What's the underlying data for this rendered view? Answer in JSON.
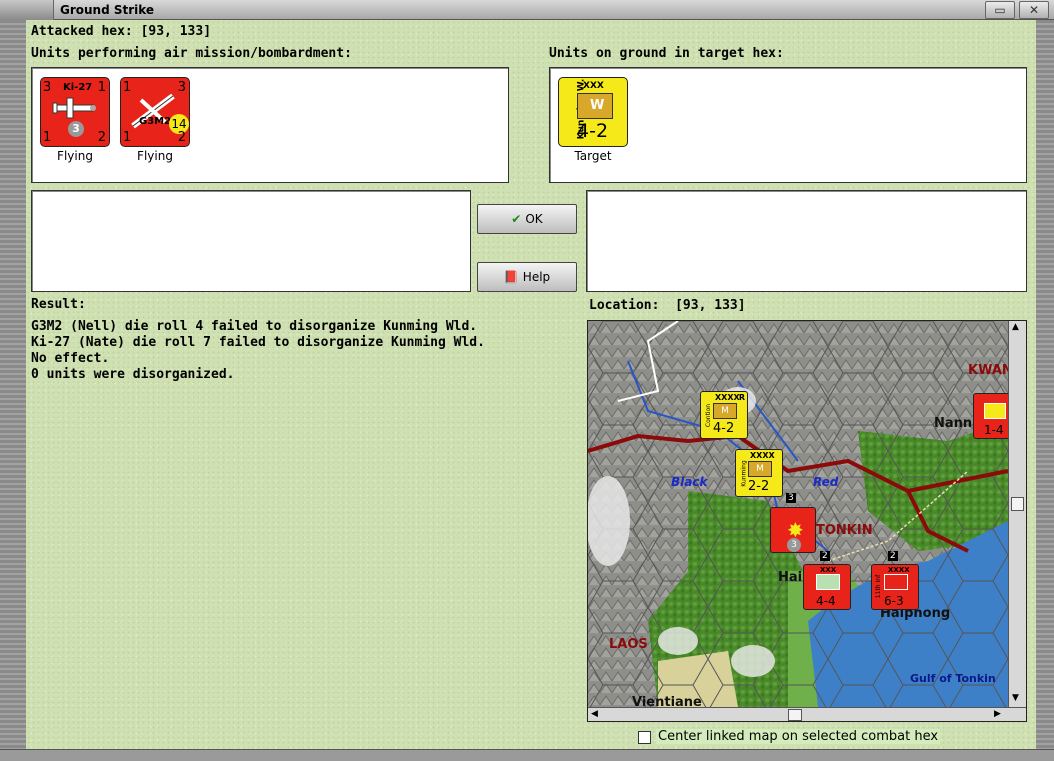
{
  "window": {
    "title": "Ground Strike"
  },
  "attacked": {
    "label": "Attacked hex:",
    "value": "[93, 133]"
  },
  "air_units": {
    "label": "Units performing air mission/bombardment:",
    "units": [
      {
        "name": "Ki-27",
        "tl": "3",
        "tr": "1",
        "bl": "1",
        "br": "2",
        "step": "3",
        "status": "Flying",
        "color": "#e8241a"
      },
      {
        "name": "G3M2",
        "tl": "1",
        "tr": "3",
        "bl": "1",
        "br": "2",
        "step": "14",
        "status": "Flying",
        "color": "#e8241a"
      }
    ]
  },
  "ground_units": {
    "label": "Units on ground in target hex:",
    "units": [
      {
        "name": "Kunming W.",
        "size": "XXX",
        "type": "W",
        "strength": "4-2",
        "status": "Target",
        "color": "#f5e91a"
      }
    ]
  },
  "buttons": {
    "ok": "OK",
    "help": "Help"
  },
  "result": {
    "label": "Result:",
    "lines": [
      "G3M2 (Nell) die roll 4 failed to disorganize Kunming Wld.",
      "Ki-27 (Nate) die roll 7 failed to disorganize Kunming Wld.",
      "No effect.",
      "0 units were disorganized."
    ]
  },
  "location": {
    "label": "Location:",
    "value": "[93, 133]"
  },
  "map": {
    "labels": [
      "KWAN",
      "Nann",
      "Black",
      "Red",
      "TONKIN",
      "Hai",
      "Haiphong",
      "LAOS",
      "Gulf of Tonkin",
      "Vientiane"
    ],
    "counters": [
      {
        "name": "Contion",
        "size": "XXXX",
        "strength": "4-2",
        "type": "M",
        "corner": "R",
        "color": "#f5e91a"
      },
      {
        "name": "Kunming",
        "size": "XXXX",
        "strength": "2-2",
        "type": "M",
        "color": "#f5e91a"
      },
      {
        "size": "XXX",
        "strength": "4-4",
        "stack": "2",
        "color": "#e8241a"
      },
      {
        "name": "11th Inf",
        "size": "XXXX",
        "strength": "6-3",
        "stack": "2",
        "color": "#e8241a"
      },
      {
        "strength": "1-4",
        "color": "#e8241a"
      },
      {
        "step": "3",
        "stack": "3",
        "color": "#e8241a"
      }
    ]
  },
  "checkbox": {
    "label": "Center linked map on selected combat hex",
    "checked": false
  },
  "colors": {
    "panel": "#cfe0b2",
    "red_counter": "#e8241a",
    "yellow_counter": "#f5e91a",
    "sea": "#3d80c8",
    "border_red": "#8b0a0a"
  }
}
